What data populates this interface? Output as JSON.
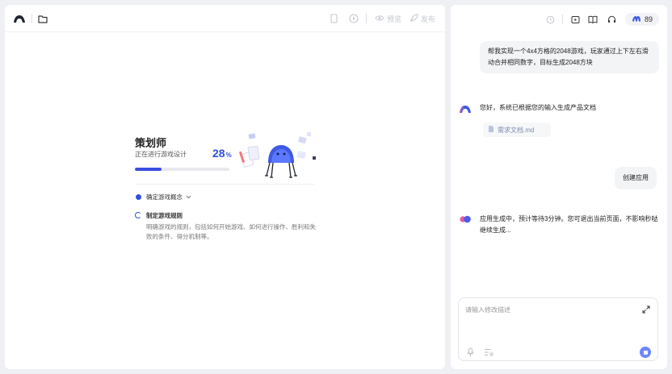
{
  "toolbar": {
    "preview_label": "预览",
    "publish_label": "发布"
  },
  "progress": {
    "title": "策划师",
    "subtitle": "正在进行游戏设计",
    "percent": "28",
    "percent_sign": "%",
    "value": 0.28
  },
  "steps": [
    {
      "label": "确定游戏概念",
      "status": "done"
    },
    {
      "label": "制定游戏规则",
      "status": "in-progress",
      "description": "明确游戏的规则，包括如何开始游戏、如何进行操作、胜利和失败的条件、得分机制等。"
    }
  ],
  "credits": {
    "count": "89"
  },
  "chat": {
    "user_message_1": "帮我实现一个4x4方格的2048游戏，玩家通过上下左右滑动合并相同数字，目标生成2048方块",
    "ai_message_1": "您好，系统已根据您的输入生成产品文档",
    "doc_chip": "需求文档.md",
    "user_message_2": "创建应用",
    "ai_message_2": "应用生成中，预计等待3分钟。您可退出当前页面，不影响秒哒继续生成..."
  },
  "composer": {
    "placeholder": "请输入修改描述"
  },
  "colors": {
    "accent": "#2f4fe0",
    "send": "#6f86ff",
    "background": "#eef0f4"
  },
  "icons": [
    "logo-icon",
    "folder-icon",
    "mobile-icon",
    "play-circle-icon",
    "eye-icon",
    "rocket-icon",
    "history-icon",
    "video-icon",
    "book-icon",
    "headset-icon",
    "expand-icon",
    "mic-icon",
    "list-settings-icon",
    "stop-icon",
    "chevron-down-icon",
    "document-icon"
  ]
}
